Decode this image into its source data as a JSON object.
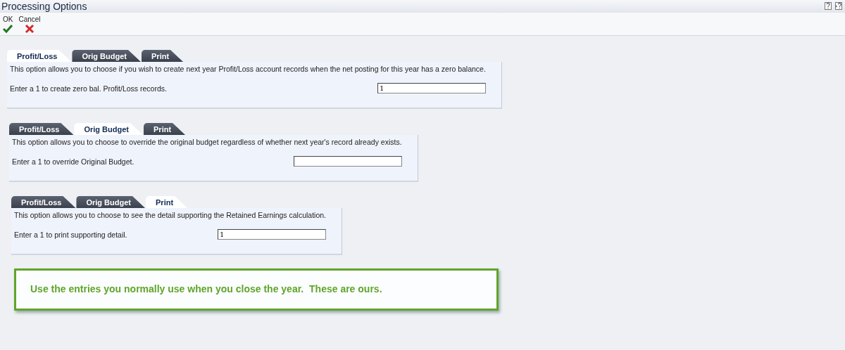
{
  "window": {
    "title": "Processing Options",
    "title_buttons": [
      {
        "label": "?",
        "kind": "help"
      },
      {
        "label": "?",
        "kind": "item-help"
      }
    ]
  },
  "toolbar": [
    {
      "label": "OK",
      "kind": "ok"
    },
    {
      "label": "Cancel",
      "kind": "cancel"
    }
  ],
  "panels": [
    {
      "tabs": [
        {
          "label": "Profit/Loss",
          "selected": true
        },
        {
          "label": "Orig Budget",
          "selected": false
        },
        {
          "label": "Print",
          "selected": false
        }
      ],
      "description": "This option allows you to choose if you wish to create next year Profit/Loss account records when the net posting for this year has a zero balance.",
      "prompt": "Enter a 1 to create zero bal. Profit/Loss records.",
      "value": "1"
    },
    {
      "tabs": [
        {
          "label": "Profit/Loss",
          "selected": false
        },
        {
          "label": "Orig Budget",
          "selected": true
        },
        {
          "label": "Print",
          "selected": false
        }
      ],
      "description": "This option allows you to choose to override the original budget regardless of whether next year's record already exists.",
      "prompt": "Enter a 1 to override Original Budget."
    },
    {
      "tabs": [
        {
          "label": "Profit/Loss",
          "selected": false
        },
        {
          "label": "Orig Budget",
          "selected": false
        },
        {
          "label": "Print",
          "selected": true
        }
      ],
      "description": "This option allows you to choose to see the detail supporting the Retained Earnings calculation.",
      "prompt": "Enter a 1 to print supporting detail.",
      "value": "1"
    }
  ],
  "callout": {
    "text": "Use the entries you normally use when you close the year.  These are ours."
  }
}
